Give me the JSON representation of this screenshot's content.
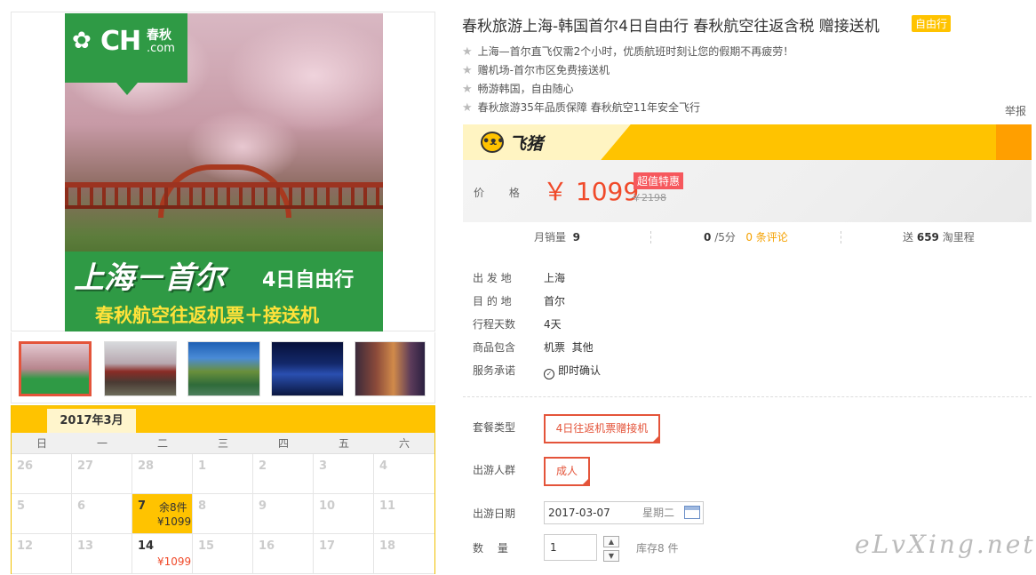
{
  "gallery": {
    "logo_text": "CH",
    "logo_cn": "春秋",
    "logo_com": ".com",
    "banner_main": "上海－首尔",
    "banner_days": "4日自由行",
    "banner_sub": "春秋航空往返机票＋接送机"
  },
  "calendar": {
    "month": "2017年3月",
    "weekdays": [
      "日",
      "一",
      "二",
      "三",
      "四",
      "五",
      "六"
    ],
    "cells": [
      {
        "day": "26"
      },
      {
        "day": "27"
      },
      {
        "day": "28"
      },
      {
        "day": "1"
      },
      {
        "day": "2"
      },
      {
        "day": "3"
      },
      {
        "day": "4"
      },
      {
        "day": "5"
      },
      {
        "day": "6"
      },
      {
        "day": "7",
        "stock": "余8件",
        "price": "¥1099",
        "selected": true
      },
      {
        "day": "8"
      },
      {
        "day": "9"
      },
      {
        "day": "10"
      },
      {
        "day": "11"
      },
      {
        "day": "12"
      },
      {
        "day": "13"
      },
      {
        "day": "14",
        "price": "¥1099",
        "available": true
      },
      {
        "day": "15"
      },
      {
        "day": "16"
      },
      {
        "day": "17"
      },
      {
        "day": "18"
      }
    ]
  },
  "product": {
    "title": "春秋旅游上海-韩国首尔4日自由行 春秋航空往返含税 赠接送机",
    "tag": "自由行",
    "highlights": [
      "上海—首尔直飞仅需2个小时，优质航班时刻让您的假期不再疲劳！",
      "赠机场-首尔市区免费接送机",
      "畅游韩国，自由随心",
      "春秋旅游35年品质保障 春秋航空11年安全飞行"
    ],
    "report": "举报"
  },
  "brand": {
    "name": "飞猪",
    "accent": "#ffc300"
  },
  "price": {
    "label": "价 格",
    "current": "￥ 1099",
    "badge": "超值特惠",
    "original": "￥2198",
    "color": "#f04a2a"
  },
  "stats": {
    "sales_label": "月销量",
    "sales": "9",
    "rating": "0",
    "rating_suffix": "/5分",
    "reviews": "0 条评论",
    "points_prefix": "送",
    "points": "659",
    "points_suffix": "淘里程"
  },
  "info": [
    {
      "k": "出 发 地",
      "v": "上海"
    },
    {
      "k": "目 的 地",
      "v": "首尔"
    },
    {
      "k": "行程天数",
      "v": "4天"
    },
    {
      "k": "商品包含",
      "v": "机票  其他"
    },
    {
      "k": "服务承诺",
      "v": "即时确认"
    }
  ],
  "options": {
    "package_label": "套餐类型",
    "package_value": "4日往返机票赠接机",
    "group_label": "出游人群",
    "group_value": "成人",
    "date_label": "出游日期",
    "date_value": "2017-03-07",
    "date_weekday": "星期二",
    "qty_label": "数　 量",
    "qty_value": "1",
    "stock": "库存8 件"
  },
  "watermark": "eLvXing.net"
}
